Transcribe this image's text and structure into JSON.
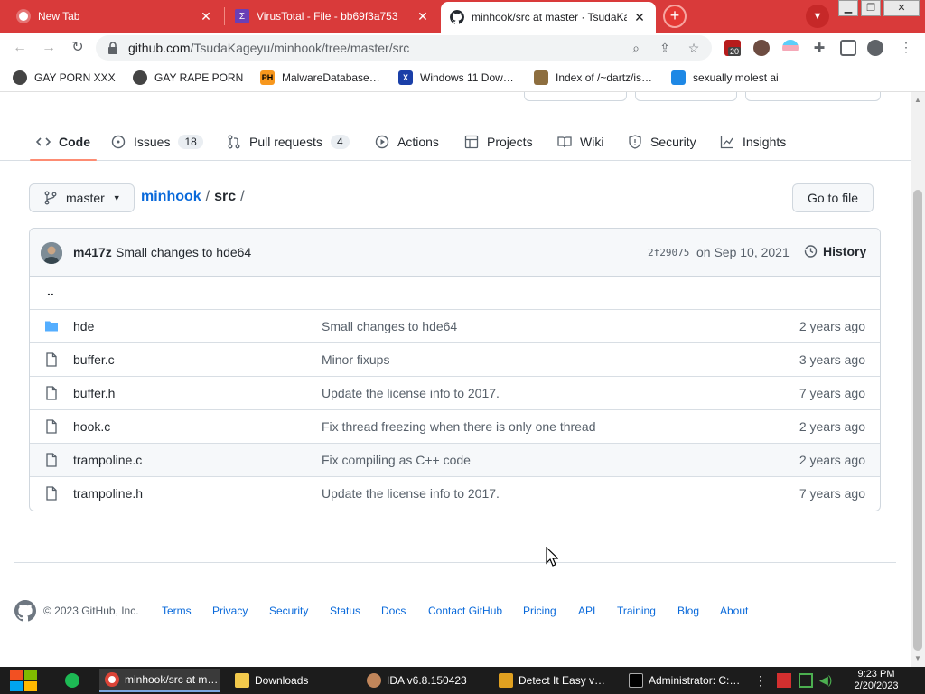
{
  "browser": {
    "tabs": [
      {
        "title": "New Tab",
        "close": "✕"
      },
      {
        "title": "VirusTotal - File - bb69f3a753",
        "close": "✕"
      },
      {
        "title": "minhook/src at master · TsudaKageyu",
        "close": "✕"
      }
    ],
    "new_tab": "+",
    "address": {
      "domain": "github.com",
      "path": "/TsudaKageyu/minhook/tree/master/src"
    },
    "extension_badge": "20",
    "bookmarks": [
      "GAY PORN XXX",
      "GAY RAPE PORN",
      "MalwareDatabase…",
      "Windows 11 Dow…",
      "Index of /~dartz/is…",
      "sexually molest ai"
    ],
    "bookmark_icon_labels": [
      "PH",
      "X"
    ]
  },
  "repo_nav": {
    "items": [
      {
        "label": "Code"
      },
      {
        "label": "Issues",
        "count": "18"
      },
      {
        "label": "Pull requests",
        "count": "4"
      },
      {
        "label": "Actions"
      },
      {
        "label": "Projects"
      },
      {
        "label": "Wiki"
      },
      {
        "label": "Security"
      },
      {
        "label": "Insights"
      }
    ]
  },
  "branch": "master",
  "breadcrumb": {
    "repo": "minhook",
    "sep": "/",
    "dir": "src",
    "trail": "/"
  },
  "goto_file": "Go to file",
  "commit": {
    "author": "m417z",
    "message": "Small changes to hde64",
    "sha": "2f29075",
    "date": "on Sep 10, 2021",
    "history": "History"
  },
  "parent_dir": "..",
  "files": [
    {
      "name": "hde",
      "type": "dir",
      "message": "Small changes to hde64",
      "age": "2 years ago"
    },
    {
      "name": "buffer.c",
      "type": "file",
      "message": "Minor fixups",
      "age": "3 years ago"
    },
    {
      "name": "buffer.h",
      "type": "file",
      "message": "Update the license info to 2017.",
      "age": "7 years ago"
    },
    {
      "name": "hook.c",
      "type": "file",
      "message": "Fix thread freezing when there is only one thread",
      "age": "2 years ago"
    },
    {
      "name": "trampoline.c",
      "type": "file",
      "message": "Fix compiling as C++ code",
      "age": "2 years ago"
    },
    {
      "name": "trampoline.h",
      "type": "file",
      "message": "Update the license info to 2017.",
      "age": "7 years ago"
    }
  ],
  "footer": {
    "copyright": "© 2023 GitHub, Inc.",
    "links": [
      "Terms",
      "Privacy",
      "Security",
      "Status",
      "Docs",
      "Contact GitHub",
      "Pricing",
      "API",
      "Training",
      "Blog",
      "About"
    ]
  },
  "taskbar": {
    "apps": [
      "minhook/src at m…",
      "Downloads",
      "IDA v6.8.150423",
      "Detect It Easy v…",
      "Administrator: C:…"
    ],
    "time": "9:23 PM",
    "date": "2/20/2023"
  },
  "colors": {
    "tab_strip": "#d93a3a",
    "link_blue": "#0969da",
    "folder_blue": "#54aeff",
    "active_underline": "#fd8c73"
  }
}
